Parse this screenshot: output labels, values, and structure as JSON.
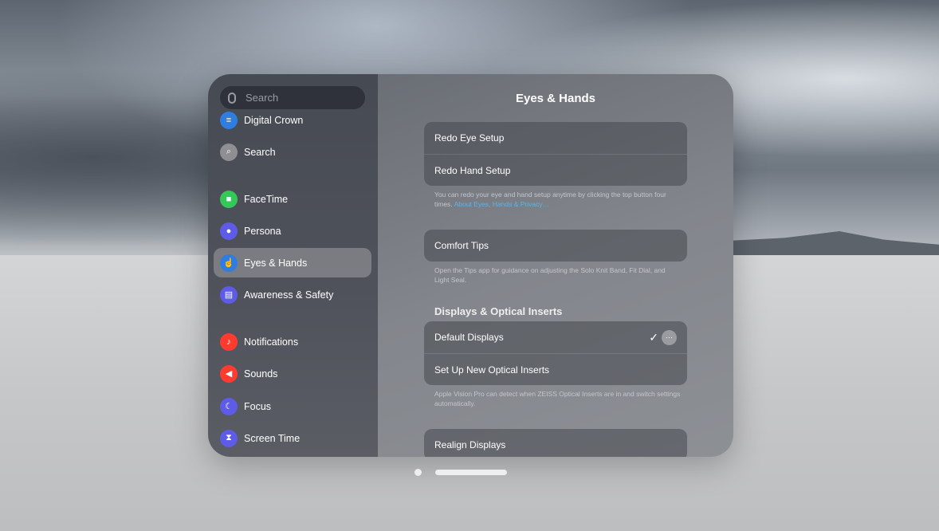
{
  "search": {
    "placeholder": "Search"
  },
  "sidebar": {
    "items": [
      {
        "label": "Digital Crown",
        "icon": "digital-crown-icon",
        "color": "#2f7de1",
        "glyph": "≡"
      },
      {
        "label": "Search",
        "icon": "search-icon",
        "color": "#8e8e93",
        "glyph": "⌕"
      },
      {
        "label": "FaceTime",
        "icon": "facetime-icon",
        "color": "#34c759",
        "glyph": "■"
      },
      {
        "label": "Persona",
        "icon": "persona-icon",
        "color": "#5e5ce6",
        "glyph": "●"
      },
      {
        "label": "Eyes & Hands",
        "icon": "hand-icon",
        "color": "#2f7de1",
        "glyph": "☝"
      },
      {
        "label": "Awareness & Safety",
        "icon": "awareness-icon",
        "color": "#5e5ce6",
        "glyph": "▤"
      },
      {
        "label": "Notifications",
        "icon": "bell-icon",
        "color": "#ff3b30",
        "glyph": "♪"
      },
      {
        "label": "Sounds",
        "icon": "speaker-icon",
        "color": "#ff3b30",
        "glyph": "◀"
      },
      {
        "label": "Focus",
        "icon": "moon-icon",
        "color": "#5e5ce6",
        "glyph": "☾"
      },
      {
        "label": "Screen Time",
        "icon": "hourglass-icon",
        "color": "#5e5ce6",
        "glyph": "⧗"
      }
    ],
    "selected": "Eyes & Hands"
  },
  "main": {
    "title": "Eyes & Hands",
    "setup": {
      "rows": [
        "Redo Eye Setup",
        "Redo Hand Setup"
      ],
      "footer": "You can redo your eye and hand setup anytime by clicking the top button four times.",
      "link": "About Eyes, Hands & Privacy…"
    },
    "comfort": {
      "row": "Comfort Tips",
      "footer": "Open the Tips app for guidance on adjusting the Solo Knit Band, Fit Dial, and Light Seal."
    },
    "displays": {
      "header": "Displays & Optical Inserts",
      "rows": [
        "Default Displays",
        "Set Up New Optical Inserts"
      ],
      "check": "✓",
      "more": "···",
      "footer": "Apple Vision Pro can detect when ZEISS Optical Inserts are in and switch settings automatically."
    },
    "realign": {
      "row": "Realign Displays"
    }
  }
}
